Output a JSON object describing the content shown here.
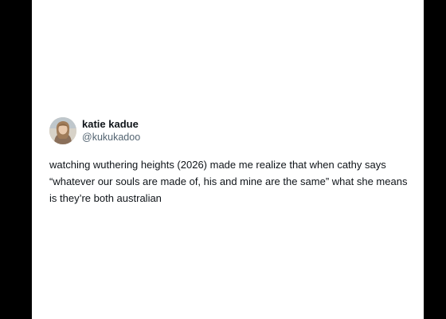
{
  "post": {
    "author": {
      "display_name": "katie kadue",
      "handle": "@kukukadoo",
      "avatar": "profile-photo"
    },
    "text": "watching wuthering heights (2026) made me realize that when cathy says “whatever our souls are made of, his and mine are the same” what she means is they’re both australian"
  },
  "colors": {
    "background": "#000000",
    "card": "#ffffff",
    "text_primary": "#0f1419",
    "text_secondary": "#536471"
  }
}
